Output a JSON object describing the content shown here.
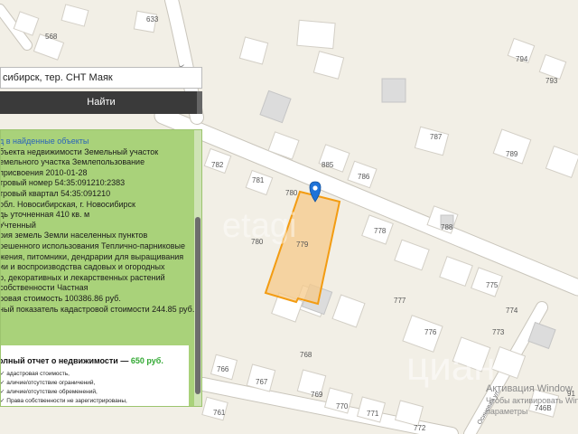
{
  "map": {
    "house_numbers": [
      "633",
      "568",
      "794",
      "793",
      "787",
      "789",
      "782",
      "885",
      "781",
      "786",
      "780",
      "780",
      "779",
      "778",
      "788",
      "775",
      "777",
      "774",
      "776",
      "773",
      "768",
      "766",
      "767",
      "769",
      "770",
      "771",
      "772",
      "761",
      "746В",
      "91"
    ],
    "streets": [
      "ул.",
      "Осиновая ул."
    ],
    "colors": {
      "plot_fill": "#f5c98a",
      "plot_stroke": "#f39c12",
      "marker": "#1f73d8",
      "panel": "#a9d27a"
    },
    "marker_icon": "map-pin-icon"
  },
  "search": {
    "value": "сибирск, тер. СНТ Маяк",
    "button_label": "Найти"
  },
  "panel": {
    "lines": [
      "д в найденные объекты",
      "бъекта недвижимости Земельный участок",
      "емельного участка Землепользование",
      "присвоения 2010-01-28",
      "тровый номер 54:35:091210:2383",
      "тровый квартал 54:35:091210",
      "обл. Новосибирская, г. Новосибирск",
      "дь уточненная 410 кв. м",
      "Учтенный",
      "рия земель Земли населенных пунктов",
      "решенного использования Теплично-парниковые",
      "жения, питомники, дендрарии для выращивания",
      "ии и воспроизводства садовых и огородных",
      "р, декоративных и лекарственных растений",
      "собственности Частная",
      "ровая стоимость 100386.86 руб.",
      "ный показатель кадастровой стоимости 244.85 руб./"
    ],
    "offer": {
      "title": "олный отчет о недвижимости —",
      "price": "650 руб.",
      "items": [
        "адастровая стоимость,",
        "аличие/отсутствие ограничений,",
        "аличие/отсутствие обременений,",
        "Права собственности не зарегистрированы,"
      ]
    }
  },
  "watermarks": {
    "etagi": "etagi",
    "cian": "циан",
    "activation_title": "Активация Window",
    "activation_text": "Чтобы активировать Windows",
    "activation_text2": "параметры"
  }
}
